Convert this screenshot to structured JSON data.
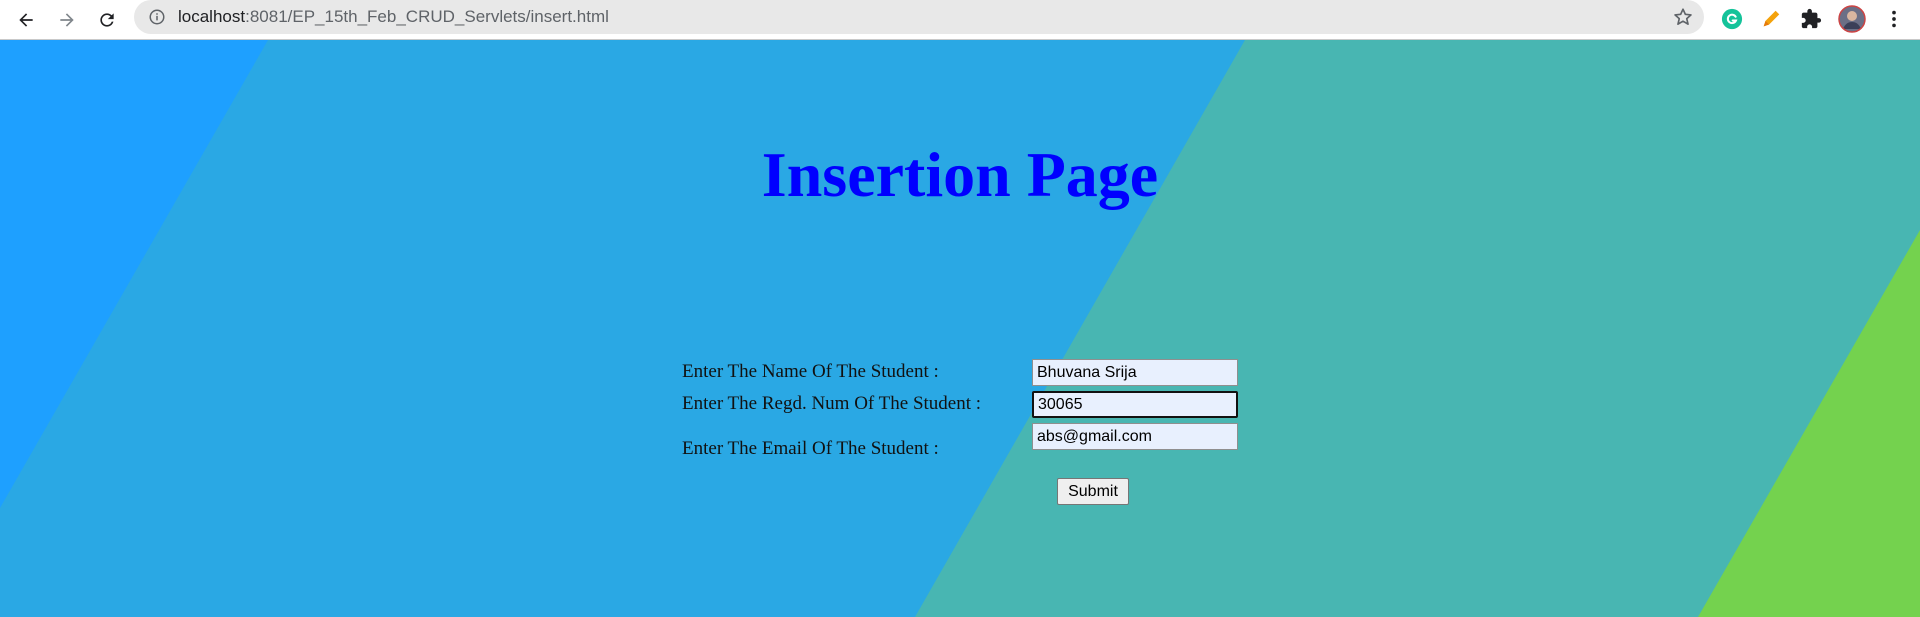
{
  "browser": {
    "url_host": "localhost",
    "url_path": ":8081/EP_15th_Feb_CRUD_Servlets/insert.html",
    "colors": {
      "toolbar": "#ffffff",
      "omnibox": "#e8e8e8"
    }
  },
  "page": {
    "heading": "Insertion Page",
    "heading_color": "#0000ff",
    "form": {
      "name_label": "Enter The Name Of The Student :",
      "name_value": "Bhuvana Srija",
      "regd_label": "Enter The Regd. Num Of The Student :",
      "regd_value": "30065",
      "email_label": "Enter The Email Of The Student :",
      "email_value": "abs@gmail.com",
      "submit_label": "Submit"
    },
    "background_colors": [
      "#1ea0ff",
      "#2aa8e4",
      "#48b6b2",
      "#74d24e"
    ]
  }
}
